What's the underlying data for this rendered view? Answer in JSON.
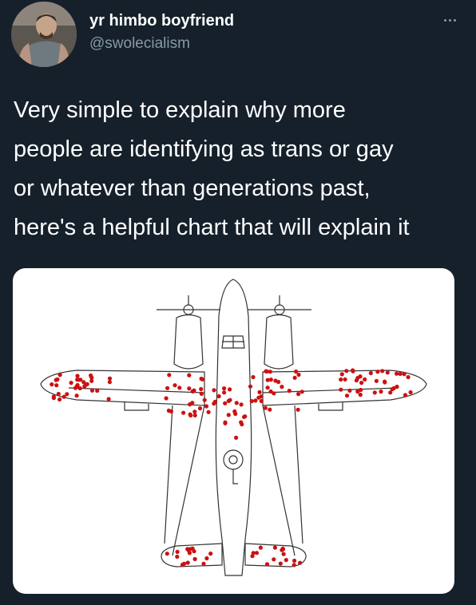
{
  "author": {
    "display_name": "yr himbo boyfriend",
    "handle": "@swolecialism",
    "avatar_icon": "profile-photo"
  },
  "menu": {
    "icon": "more-dots-icon"
  },
  "tweet": {
    "lines": [
      "Very simple to explain why more",
      "people are identifying as trans or gay",
      "or whatever than generations past,",
      "here's a helpful chart that will explain it"
    ]
  },
  "media": {
    "subject": "survivorship-bias-airplane",
    "marker_color": "#cc1111",
    "line_color": "#333333"
  },
  "colors": {
    "background": "#15202b",
    "secondary_text": "#8899a6"
  }
}
